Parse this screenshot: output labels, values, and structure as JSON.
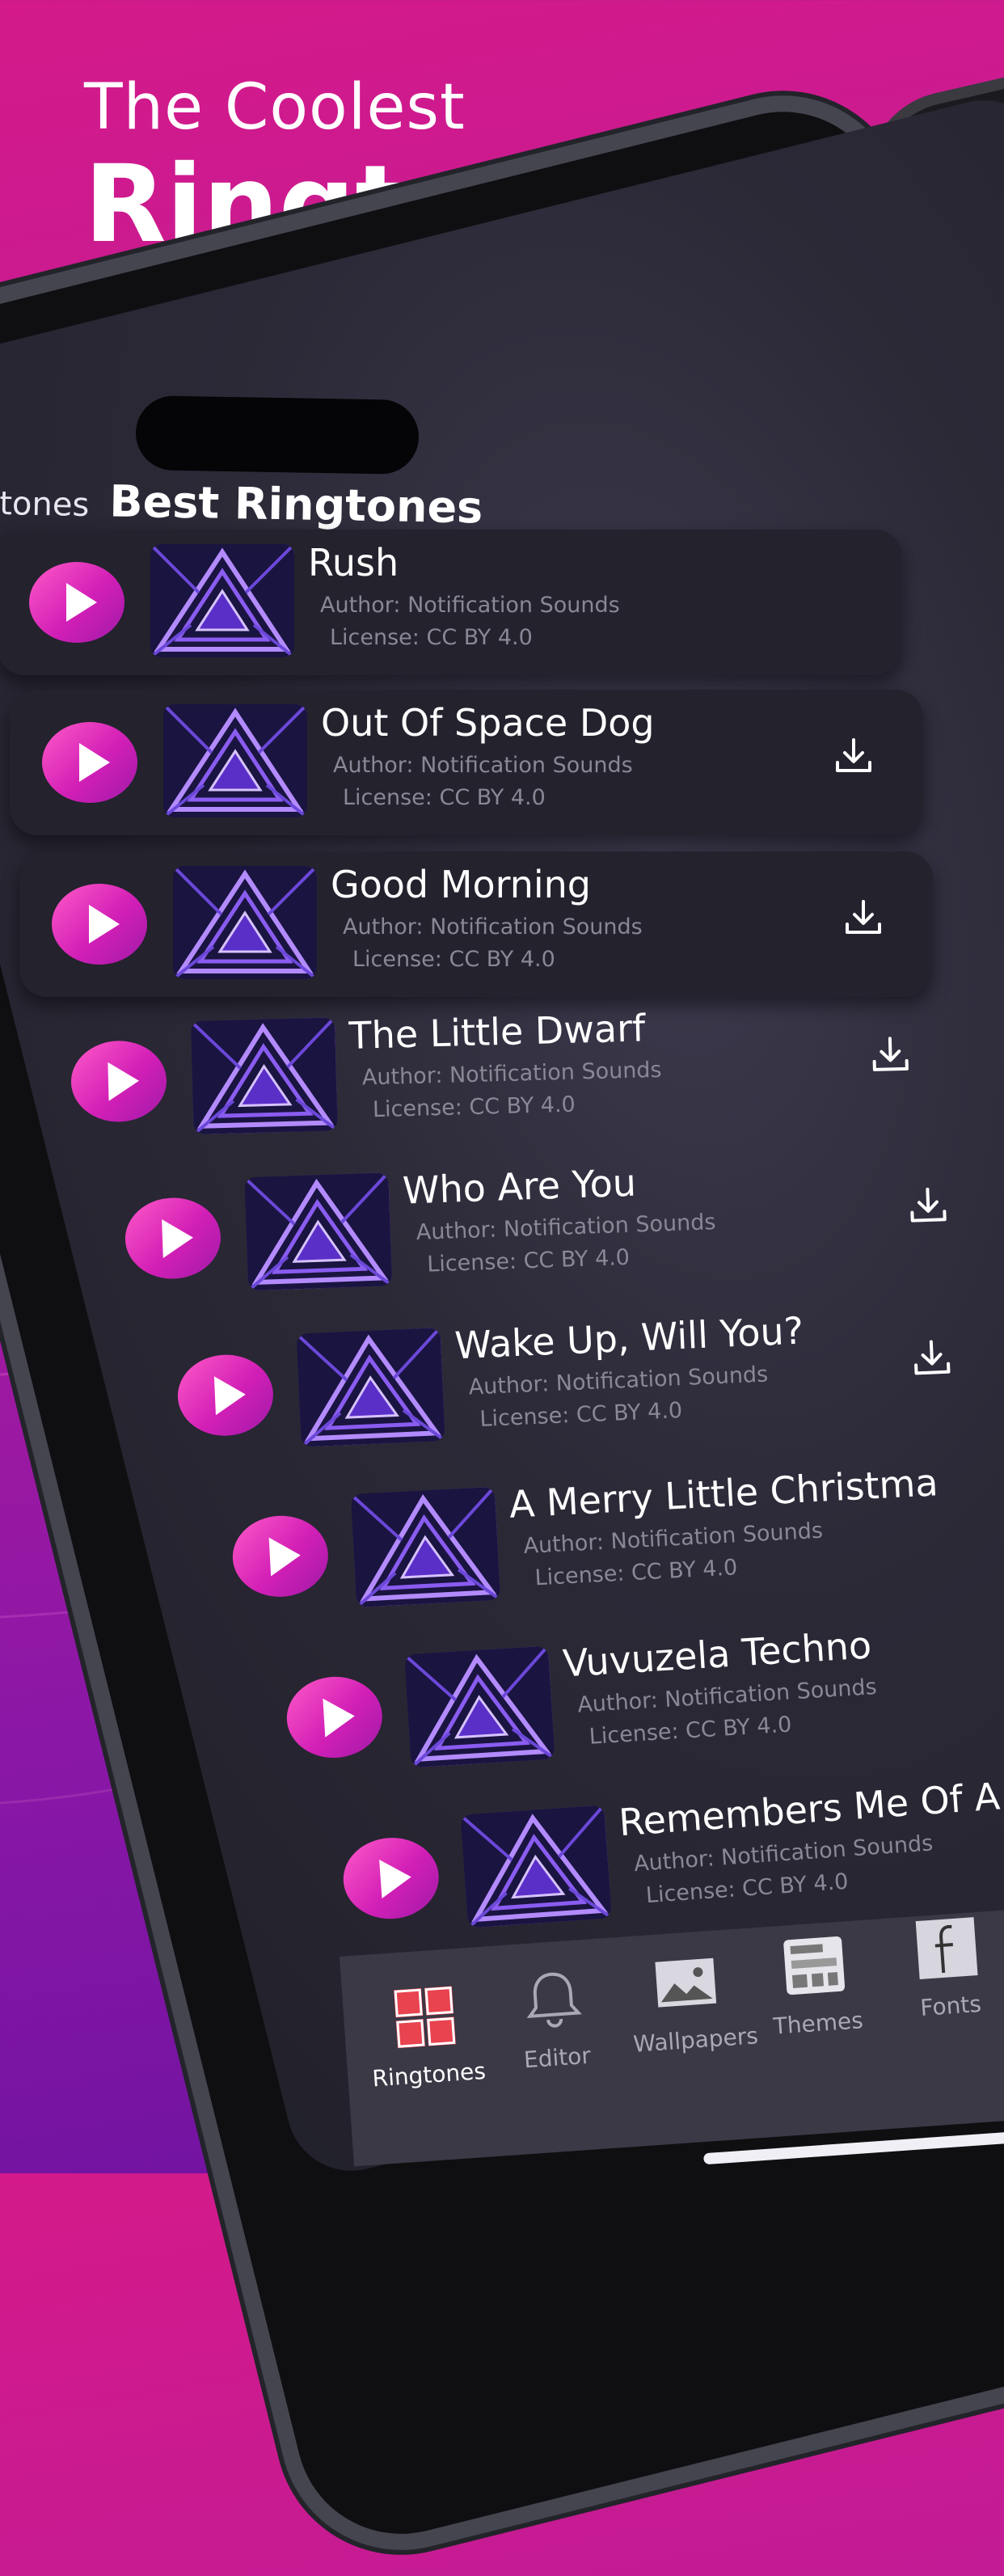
{
  "headline": {
    "line1": "The Coolest",
    "line2": "Ringtones"
  },
  "tabs_header": {
    "previous": "tones",
    "current": "Best Ringtones"
  },
  "ringtones": [
    {
      "title": "Rush",
      "author": "Author: Notification Sounds",
      "license": "License: CC BY 4.0"
    },
    {
      "title": "Out Of Space Dog",
      "author": "Author: Notification Sounds",
      "license": "License: CC BY 4.0"
    },
    {
      "title": "Good Morning",
      "author": "Author: Notification Sounds",
      "license": "License: CC BY 4.0"
    },
    {
      "title": "The Little Dwarf",
      "author": "Author: Notification Sounds",
      "license": "License: CC BY 4.0"
    },
    {
      "title": "Who Are You",
      "author": "Author: Notification Sounds",
      "license": "License: CC BY 4.0"
    },
    {
      "title": "Wake Up, Will You?",
      "author": "Author: Notification Sounds",
      "license": "License: CC BY 4.0"
    },
    {
      "title": "A Merry Little Christma",
      "author": "Author: Notification Sounds",
      "license": "License: CC BY 4.0"
    },
    {
      "title": "Vuvuzela Techno",
      "author": "Author: Notification Sounds",
      "license": "License: CC BY 4.0"
    },
    {
      "title": "Remembers Me Of A",
      "author": "Author: Notification Sounds",
      "license": "License: CC BY 4.0"
    }
  ],
  "tabbar": [
    {
      "label": "Ringtones",
      "icon": "grid-icon",
      "active": true
    },
    {
      "label": "Editor",
      "icon": "bell-icon"
    },
    {
      "label": "Wallpapers",
      "icon": "image-icon"
    },
    {
      "label": "Themes",
      "icon": "widget-icon"
    },
    {
      "label": "Fonts",
      "icon": "font-icon"
    }
  ],
  "colors": {
    "accent": "#d21fb6",
    "background": "#c21b95",
    "card": "#23222d"
  }
}
